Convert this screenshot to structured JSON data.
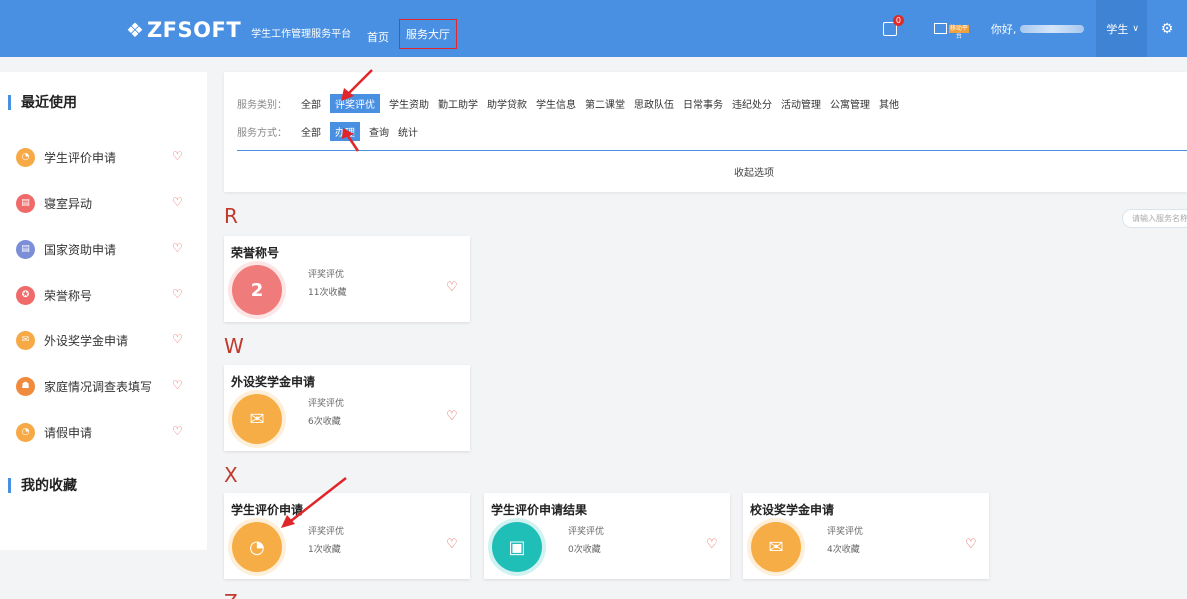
{
  "header": {
    "logo_mark": "❖",
    "logo_text": "ZFSOFT",
    "logo_sub": "学生工作管理服务平台",
    "nav": [
      "首页",
      "服务大厅"
    ],
    "bell_count": "0",
    "greeting": "你好,",
    "role": "学生",
    "mini_badge": "移动平台"
  },
  "sidebar": {
    "recent_title": "最近使用",
    "favorites_title": "我的收藏",
    "items": [
      {
        "label": "学生评价申请",
        "color": "#f6a944",
        "glyph": "◔"
      },
      {
        "label": "寝室异动",
        "color": "#f06a6a",
        "glyph": "▤"
      },
      {
        "label": "国家资助申请",
        "color": "#7b8fd9",
        "glyph": "▤"
      },
      {
        "label": "荣誉称号",
        "color": "#f06a6a",
        "glyph": "✪"
      },
      {
        "label": "外设奖学金申请",
        "color": "#f6a944",
        "glyph": "✉"
      },
      {
        "label": "家庭情况调查表填写",
        "color": "#f08a3c",
        "glyph": "☗"
      },
      {
        "label": "请假申请",
        "color": "#f6a944",
        "glyph": "◔"
      }
    ]
  },
  "filter": {
    "category_label": "服务类别：",
    "categories": [
      "全部",
      "评奖评优",
      "学生资助",
      "勤工助学",
      "助学贷款",
      "学生信息",
      "第二课堂",
      "思政队伍",
      "日常事务",
      "违纪处分",
      "活动管理",
      "公寓管理",
      "其他"
    ],
    "active_category": "评奖评优",
    "method_label": "服务方式：",
    "methods": [
      "全部",
      "办理",
      "查询",
      "统计"
    ],
    "active_method": "办理",
    "collapse": "收起选项"
  },
  "search": {
    "placeholder": "请输入服务名称"
  },
  "groups": [
    {
      "letter": "R",
      "cards": [
        {
          "title": "荣誉称号",
          "category": "评奖评优",
          "count": "11次收藏",
          "color": "#f07b7b",
          "glyph": "2"
        }
      ]
    },
    {
      "letter": "W",
      "cards": [
        {
          "title": "外设奖学金申请",
          "category": "评奖评优",
          "count": "6次收藏",
          "color": "#f6ad45",
          "glyph": "✉"
        }
      ]
    },
    {
      "letter": "X",
      "cards": [
        {
          "title": "学生评价申请",
          "category": "评奖评优",
          "count": "1次收藏",
          "color": "#f6ad45",
          "glyph": "◔"
        },
        {
          "title": "学生评价申请结果",
          "category": "评奖评优",
          "count": "0次收藏",
          "color": "#1fbfb8",
          "glyph": "▣"
        },
        {
          "title": "校设奖学金申请",
          "category": "评奖评优",
          "count": "4次收藏",
          "color": "#f6ad45",
          "glyph": "✉"
        }
      ]
    },
    {
      "letter": "Z",
      "cards": []
    }
  ],
  "heart_glyph": "♡"
}
